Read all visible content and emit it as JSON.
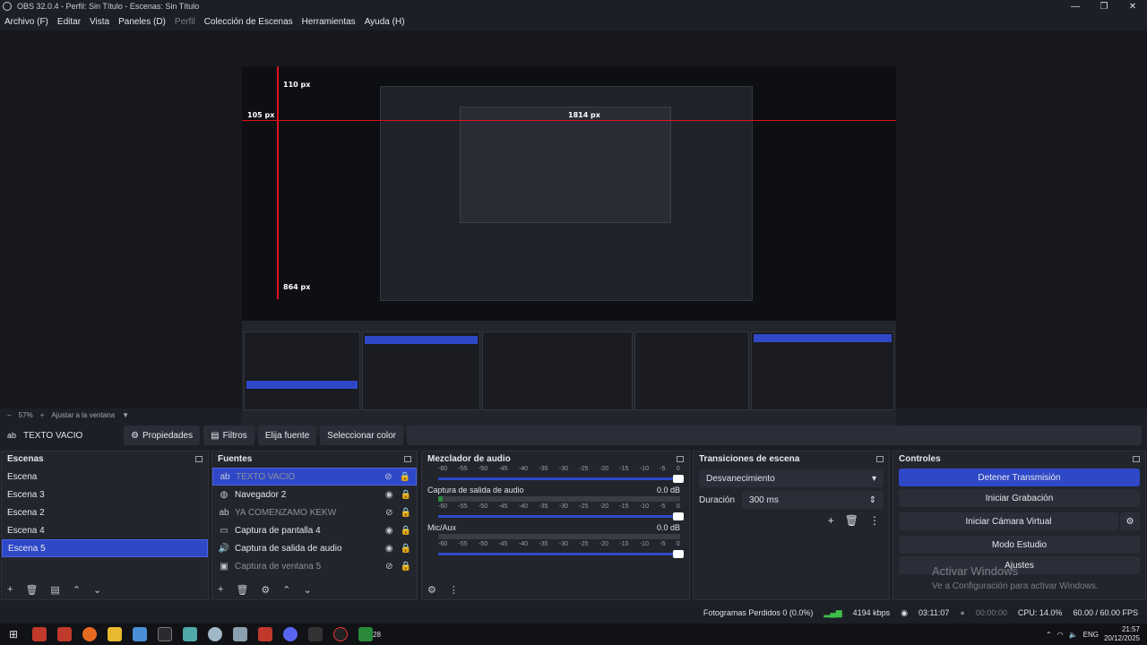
{
  "window": {
    "title": "OBS 32.0.4 - Perfil: Sin Título - Escenas: Sin Título",
    "controls": [
      "—",
      "❐",
      "✕"
    ]
  },
  "menu": [
    "Archivo (F)",
    "Editar",
    "Vista",
    "Paneles (D)",
    "Perfil",
    "Colección de Escenas",
    "Herramientas",
    "Ayuda (H)"
  ],
  "preview": {
    "guides": {
      "top": "110 px",
      "left": "105 px",
      "bottom": "864 px",
      "right": "1814 px"
    },
    "zoom": "57%",
    "fit": "Ajustar a la ventana"
  },
  "toolbar": {
    "source_name": "TEXTO VACIO",
    "buttons": [
      "Propiedades",
      "Filtros",
      "Elija fuente",
      "Seleccionar color"
    ]
  },
  "scenes": {
    "title": "Escenas",
    "items": [
      "Escena",
      "Escena 3",
      "Escena 2",
      "Escena 4",
      "Escena 5"
    ],
    "selected_index": 4
  },
  "sources": {
    "title": "Fuentes",
    "items": [
      {
        "label": "TEXTO VACIO",
        "icon": "text-icon",
        "visible": false,
        "selected": true
      },
      {
        "label": "Navegador 2",
        "icon": "globe-icon",
        "visible": true,
        "selected": false
      },
      {
        "label": "YA COMENZAMO KEKW",
        "icon": "text-icon",
        "visible": false,
        "selected": false
      },
      {
        "label": "Captura de pantalla 4",
        "icon": "monitor-icon",
        "visible": true,
        "selected": false
      },
      {
        "label": "Captura de salida de audio",
        "icon": "speaker-icon",
        "visible": true,
        "selected": false
      },
      {
        "label": "Captura de ventana 5",
        "icon": "window-icon",
        "visible": false,
        "selected": false
      }
    ]
  },
  "mixer": {
    "title": "Mezclador de audio",
    "scale": [
      "-60",
      "-55",
      "-50",
      "-45",
      "-40",
      "-35",
      "-30",
      "-25",
      "-20",
      "-15",
      "-10",
      "-5",
      "0"
    ],
    "tracks": [
      {
        "name": "Captura de salida de audio",
        "db": "0.0 dB"
      },
      {
        "name": "Mic/Aux",
        "db": "0.0 dB"
      }
    ]
  },
  "transitions": {
    "title": "Transiciones de escena",
    "selected": "Desvanecimiento",
    "duration_label": "Duración",
    "duration_value": "300 ms"
  },
  "controls": {
    "title": "Controles",
    "buttons": [
      "Detener Transmisión",
      "Iniciar Grabación",
      "Iniciar Cámara Virtual",
      "Modo Estudio",
      "Ajustes"
    ]
  },
  "activation": {
    "title": "Activar Windows",
    "subtitle": "Ve a Configuración para activar Windows."
  },
  "status": {
    "dropped": "Fotogramas Perdidos 0 (0.0%)",
    "bitrate": "4194 kbps",
    "stream_time": "03:11:07",
    "rec_time": "00:00:00",
    "cpu": "CPU: 14.0%",
    "fps": "60.00 / 60.00 FPS"
  },
  "taskbar": {
    "lang": "ENG",
    "time": "21:57",
    "date": "20/12/2025",
    "badge": "28"
  },
  "colors": {
    "accent": "#2f48c8",
    "guide": "#e0101c",
    "bg": "#1d1f26"
  }
}
